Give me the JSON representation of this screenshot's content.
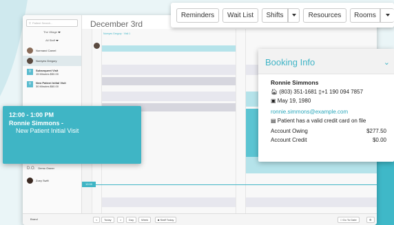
{
  "sidebar": {
    "search_placeholder": "Patient Search...",
    "location": "The Village",
    "staff_filter": "All Staff",
    "practitioners": [
      {
        "name": "Normand Carnel"
      },
      {
        "name": "Noreyes Gregory"
      },
      {
        "name": "Subsequent Visit",
        "sub": "15 Minutes $50.00"
      },
      {
        "name": "New Patient Initial Visit",
        "sub": "30 Minutes $60.00"
      }
    ],
    "bottom_practitioners": [
      {
        "initials": "D.O.",
        "name": "Demo Owner"
      },
      {
        "name": "Zoey Swift"
      }
    ],
    "brand": "Brand"
  },
  "main": {
    "date": "December 3rd",
    "column_header": "Noreyes Gregory",
    "column_sub": "Visit 1",
    "now_time": "12:00"
  },
  "bottom_bar": {
    "prev": "<",
    "today": "Today",
    "next": ">",
    "day": "Day",
    "week": "Week",
    "staff_today": "Staff Today",
    "go_to_date": "Go To Date",
    "settings": "⚙"
  },
  "toolbar": {
    "reminders": "Reminders",
    "wait_list": "Wait List",
    "shifts": "Shifts",
    "resources": "Resources",
    "rooms": "Rooms"
  },
  "booking_info": {
    "title": "Booking Info",
    "name": "Ronnie Simmons",
    "phone_home": "(803) 351-1681",
    "phone_mobile": "+1 190 094 7857",
    "birthday": "May 19, 1980",
    "email": "ronnie.simmons@example.com",
    "card_status": "Patient has a valid credit card on file",
    "account_owing_label": "Account Owing",
    "account_owing": "$277.50",
    "account_credit_label": "Account Credit",
    "account_credit": "$0.00"
  },
  "popup": {
    "time": "12:00 - 1:00 PM",
    "name": "Ronnie Simmons -",
    "type": "New Patient Initial Visit"
  },
  "colors": {
    "accent": "#3fb5c5",
    "accent_light": "#b5e3ea",
    "grey_block": "#d6d6de"
  }
}
